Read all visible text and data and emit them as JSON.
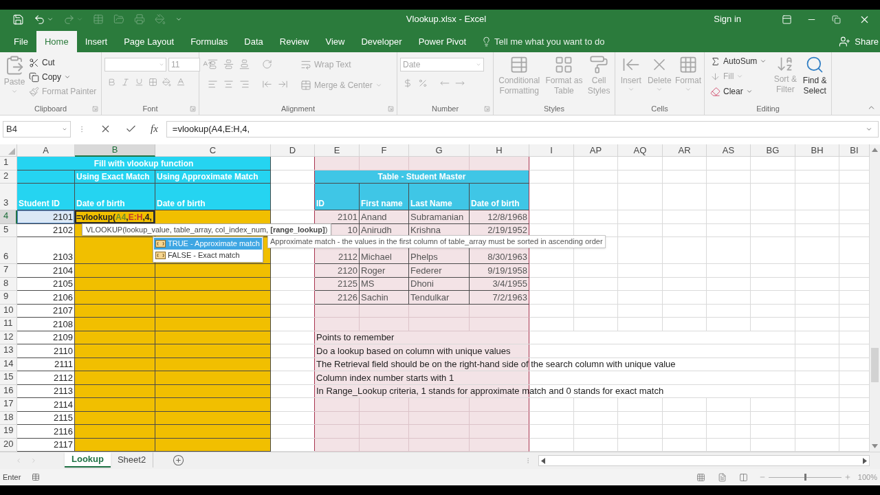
{
  "title_bar": {
    "title": "Vlookup.xlsx  -  Excel",
    "sign_in": "Sign in"
  },
  "ribbon_tabs": [
    {
      "label": "File",
      "selected": false
    },
    {
      "label": "Home",
      "selected": true
    },
    {
      "label": "Insert",
      "selected": false
    },
    {
      "label": "Page Layout",
      "selected": false
    },
    {
      "label": "Formulas",
      "selected": false
    },
    {
      "label": "Data",
      "selected": false
    },
    {
      "label": "Review",
      "selected": false
    },
    {
      "label": "View",
      "selected": false
    },
    {
      "label": "Developer",
      "selected": false
    },
    {
      "label": "Power Pivot",
      "selected": false
    }
  ],
  "tell_me": "Tell me what you want to do",
  "share": "Share",
  "ribbon": {
    "clipboard": {
      "label": "Clipboard",
      "paste": {
        "label": "Paste",
        "disabled": true
      },
      "cut": {
        "label": "Cut",
        "disabled": false
      },
      "copy": {
        "label": "Copy",
        "disabled": false
      },
      "format_painter": {
        "label": "Format Painter",
        "disabled": true
      }
    },
    "font": {
      "label": "Font",
      "size": "11"
    },
    "alignment": {
      "label": "Alignment",
      "wrap_text": "Wrap Text",
      "merge_center": "Merge & Center"
    },
    "number": {
      "label": "Number",
      "format": "Date"
    },
    "styles": {
      "label": "Styles",
      "commands": [
        "Conditional Formatting",
        "Format as Table",
        "Cell Styles"
      ]
    },
    "cells": {
      "label": "Cells",
      "commands": [
        "Insert",
        "Delete",
        "Format"
      ]
    },
    "editing": {
      "label": "Editing",
      "autosum": {
        "label": "AutoSum",
        "disabled": false
      },
      "fill": {
        "label": "Fill",
        "disabled": true
      },
      "clear": {
        "label": "Clear",
        "disabled": false
      },
      "sort_filter": {
        "label": "Sort & Filter",
        "disabled": true
      },
      "find_select": {
        "label": "Find & Select",
        "disabled": false
      }
    }
  },
  "formula_bar": {
    "name_box": "B4",
    "insert_function": "fx",
    "formula": "=vlookup(A4,E:H,4,"
  },
  "columns": [
    {
      "label": "A",
      "selected": false
    },
    {
      "label": "B",
      "selected": true
    },
    {
      "label": "C",
      "selected": false
    },
    {
      "label": "D",
      "selected": false
    },
    {
      "label": "E",
      "selected": false
    },
    {
      "label": "F",
      "selected": false
    },
    {
      "label": "G",
      "selected": false
    },
    {
      "label": "H",
      "selected": false
    },
    {
      "label": "I",
      "selected": false
    },
    {
      "label": "AP",
      "selected": false
    },
    {
      "label": "AQ",
      "selected": false
    },
    {
      "label": "AR",
      "selected": false
    },
    {
      "label": "AS",
      "selected": false
    },
    {
      "label": "BG",
      "selected": false
    },
    {
      "label": "BH",
      "selected": false
    },
    {
      "label": "BI",
      "selected": false
    }
  ],
  "rows": [
    {
      "label": "1",
      "selected": false
    },
    {
      "label": "2",
      "selected": false
    },
    {
      "label": "3",
      "selected": false
    },
    {
      "label": "4",
      "selected": true
    },
    {
      "label": "5",
      "selected": false
    },
    {
      "label": "6",
      "selected": false
    },
    {
      "label": "7",
      "selected": false
    },
    {
      "label": "8",
      "selected": false
    },
    {
      "label": "9",
      "selected": false
    },
    {
      "label": "10",
      "selected": false
    },
    {
      "label": "11",
      "selected": false
    },
    {
      "label": "12",
      "selected": false
    },
    {
      "label": "13",
      "selected": false
    },
    {
      "label": "14",
      "selected": false
    },
    {
      "label": "15",
      "selected": false
    },
    {
      "label": "16",
      "selected": false
    },
    {
      "label": "17",
      "selected": false
    },
    {
      "label": "18",
      "selected": false
    },
    {
      "label": "19",
      "selected": false
    },
    {
      "label": "20",
      "selected": false
    }
  ],
  "left_table": {
    "title": "Fill with vlookup function",
    "subheaders": [
      "Using Exact Match",
      "Using Approximate Match"
    ],
    "headers": [
      "Student ID",
      "Date of birth",
      "Date of birth"
    ],
    "student_ids": [
      {
        "id": "2101",
        "highlighted": true
      },
      {
        "id": "2102",
        "highlighted": false
      },
      {
        "id": "2103",
        "highlighted": false
      },
      {
        "id": "2104",
        "highlighted": false
      },
      {
        "id": "2105",
        "highlighted": false
      },
      {
        "id": "2106",
        "highlighted": false
      },
      {
        "id": "2107",
        "highlighted": false
      },
      {
        "id": "2108",
        "highlighted": false
      },
      {
        "id": "2109",
        "highlighted": false
      },
      {
        "id": "2110",
        "highlighted": false
      },
      {
        "id": "2111",
        "highlighted": false
      },
      {
        "id": "2112",
        "highlighted": false
      },
      {
        "id": "2113",
        "highlighted": false
      },
      {
        "id": "2114",
        "highlighted": false
      },
      {
        "id": "2115",
        "highlighted": false
      },
      {
        "id": "2116",
        "highlighted": false
      },
      {
        "id": "2117",
        "highlighted": false
      }
    ],
    "editing_cell": [
      {
        "text": "=vlookup(",
        "kind": "text"
      },
      {
        "text": "A4",
        "kind": "reference"
      },
      {
        "text": ",",
        "kind": "text"
      },
      {
        "text": "E:H",
        "kind": "reference"
      },
      {
        "text": ",4,",
        "kind": "text"
      }
    ]
  },
  "master_table": {
    "title": "Table - Student Master",
    "headers": [
      "ID",
      "First name",
      "Last Name",
      "Date of birth"
    ],
    "rows": [
      [
        "2101",
        "Anand",
        "Subramanian",
        "12/8/1968"
      ],
      [
        "10",
        "Anirudh",
        "Krishna",
        "2/19/1952"
      ],
      [
        "2112",
        "Michael",
        "Phelps",
        "8/30/1963"
      ],
      [
        "2120",
        "Roger",
        "Federer",
        "9/19/1958"
      ],
      [
        "2125",
        "MS",
        "Dhoni",
        "3/4/1955"
      ],
      [
        "2126",
        "Sachin",
        "Tendulkar",
        "7/2/1963"
      ]
    ]
  },
  "notes": [
    "Points to remember",
    "Do a lookup based on column with unique values",
    "The Retrieval field should be on the right-hand side of the search column with unique value",
    "Column index number starts with 1",
    "In Range_Lookup criteria, 1 stands for approximate match and 0 stands for exact match"
  ],
  "function_tooltip": "VLOOKUP(lookup_value, table_array, col_index_num, **[range_lookup]**)",
  "autocomplete": [
    {
      "label": "TRUE - Approximate match",
      "selected": true
    },
    {
      "label": "FALSE - Exact match",
      "selected": false
    }
  ],
  "hint": "Approximate match - the values in the first column of table_array must be sorted in ascending order",
  "sheet_tabs": [
    {
      "label": "Lookup",
      "selected": true
    },
    {
      "label": "Sheet2",
      "selected": false
    }
  ],
  "status_bar": {
    "mode": "Enter",
    "zoom": "100%",
    "zoom_slider": {
      "level": 0.5
    }
  }
}
